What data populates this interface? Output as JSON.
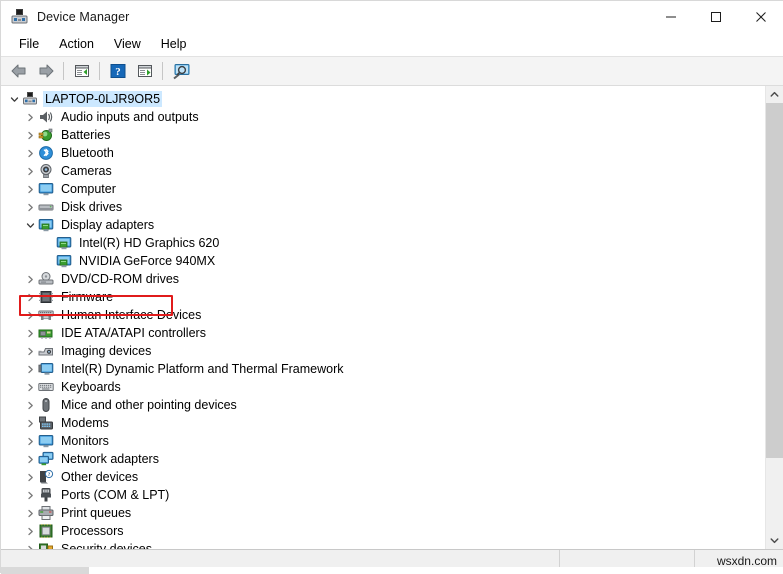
{
  "window": {
    "title": "Device Manager",
    "icon": "device-manager-icon",
    "controls": [
      {
        "name": "minimize-button",
        "glyph": "–"
      },
      {
        "name": "maximize-button",
        "glyph": "□"
      },
      {
        "name": "close-button",
        "glyph": "✕"
      }
    ]
  },
  "menu": {
    "items": [
      {
        "label": "File"
      },
      {
        "label": "Action"
      },
      {
        "label": "View"
      },
      {
        "label": "Help"
      }
    ]
  },
  "toolbar": {
    "buttons": [
      {
        "name": "back-button",
        "icon": "back-arrow-icon",
        "tooltip": "Back"
      },
      {
        "name": "forward-button",
        "icon": "forward-arrow-icon",
        "tooltip": "Forward"
      },
      {
        "name": "show-hide-console-tree-button",
        "icon": "console-tree-icon",
        "tooltip": "Show/Hide Console Tree"
      },
      {
        "name": "help-button",
        "icon": "help-question-icon",
        "tooltip": "Help"
      },
      {
        "name": "properties-button",
        "icon": "properties-icon",
        "tooltip": "Properties"
      },
      {
        "name": "scan-for-hardware-changes-button",
        "icon": "scan-hardware-icon",
        "tooltip": "Scan for hardware changes"
      }
    ]
  },
  "tree": {
    "root": {
      "label": "LAPTOP-0LJR9OR5",
      "icon": "computer-icon",
      "expanded": true,
      "selected": true
    },
    "nodes": [
      {
        "label": "Audio inputs and outputs",
        "icon": "speaker-icon",
        "expanded": false,
        "level": 1
      },
      {
        "label": "Batteries",
        "icon": "battery-icon",
        "expanded": false,
        "level": 1
      },
      {
        "label": "Bluetooth",
        "icon": "bluetooth-icon",
        "expanded": false,
        "level": 1
      },
      {
        "label": "Cameras",
        "icon": "camera-icon",
        "expanded": false,
        "level": 1
      },
      {
        "label": "Computer",
        "icon": "monitor-icon",
        "expanded": false,
        "level": 1
      },
      {
        "label": "Disk drives",
        "icon": "disk-drive-icon",
        "expanded": false,
        "level": 1
      },
      {
        "label": "Display adapters",
        "icon": "display-adapter-icon",
        "expanded": true,
        "level": 1,
        "highlighted": true
      },
      {
        "label": "Intel(R) HD Graphics 620",
        "icon": "display-adapter-icon",
        "expanded": null,
        "level": 2
      },
      {
        "label": "NVIDIA GeForce 940MX",
        "icon": "display-adapter-icon",
        "expanded": null,
        "level": 2
      },
      {
        "label": "DVD/CD-ROM drives",
        "icon": "optical-drive-icon",
        "expanded": false,
        "level": 1
      },
      {
        "label": "Firmware",
        "icon": "firmware-chip-icon",
        "expanded": false,
        "level": 1
      },
      {
        "label": "Human Interface Devices",
        "icon": "hid-icon",
        "expanded": false,
        "level": 1
      },
      {
        "label": "IDE ATA/ATAPI controllers",
        "icon": "ide-controller-icon",
        "expanded": false,
        "level": 1
      },
      {
        "label": "Imaging devices",
        "icon": "imaging-device-icon",
        "expanded": false,
        "level": 1
      },
      {
        "label": "Intel(R) Dynamic Platform and Thermal Framework",
        "icon": "thermal-framework-icon",
        "expanded": false,
        "level": 1
      },
      {
        "label": "Keyboards",
        "icon": "keyboard-icon",
        "expanded": false,
        "level": 1
      },
      {
        "label": "Mice and other pointing devices",
        "icon": "mouse-icon",
        "expanded": false,
        "level": 1
      },
      {
        "label": "Modems",
        "icon": "modem-icon",
        "expanded": false,
        "level": 1
      },
      {
        "label": "Monitors",
        "icon": "monitor-icon",
        "expanded": false,
        "level": 1
      },
      {
        "label": "Network adapters",
        "icon": "network-adapter-icon",
        "expanded": false,
        "level": 1
      },
      {
        "label": "Other devices",
        "icon": "other-device-question-icon",
        "expanded": false,
        "level": 1
      },
      {
        "label": "Ports (COM & LPT)",
        "icon": "port-connector-icon",
        "expanded": false,
        "level": 1
      },
      {
        "label": "Print queues",
        "icon": "printer-icon",
        "expanded": false,
        "level": 1
      },
      {
        "label": "Processors",
        "icon": "processor-chip-icon",
        "expanded": false,
        "level": 1
      },
      {
        "label": "Security devices",
        "icon": "security-device-icon",
        "expanded": false,
        "level": 1
      }
    ]
  },
  "scrollbar": {
    "up_arrow": "˄",
    "down_arrow": "˅"
  },
  "status_bar": {
    "main_text": "",
    "mid_text": "",
    "right_text": "wsxdn.com"
  },
  "colors": {
    "highlight_border": "#e01b1b",
    "selection": "#cce8ff",
    "toolbar_bg": "#f4f4f4",
    "status_bg": "#f0f0f0"
  }
}
